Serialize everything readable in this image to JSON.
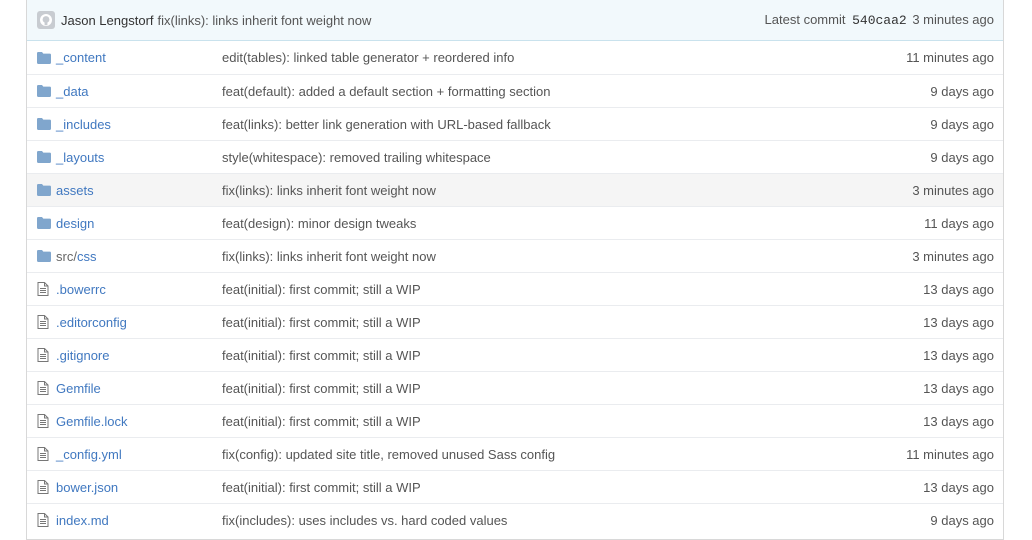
{
  "commit": {
    "author": "Jason Lengstorf",
    "message": "fix(links): links inherit font weight now",
    "latest_label": "Latest commit",
    "sha": "540caa2",
    "age": "3 minutes ago"
  },
  "files": [
    {
      "type": "dir",
      "name": "_content",
      "message": "edit(tables): linked table generator + reordered info",
      "age": "11 minutes ago"
    },
    {
      "type": "dir",
      "name": "_data",
      "message": "feat(default): added a default section + formatting section",
      "age": "9 days ago"
    },
    {
      "type": "dir",
      "name": "_includes",
      "message": "feat(links): better link generation with URL-based fallback",
      "age": "9 days ago"
    },
    {
      "type": "dir",
      "name": "_layouts",
      "message": "style(whitespace): removed trailing whitespace",
      "age": "9 days ago"
    },
    {
      "type": "dir",
      "name": "assets",
      "message": "fix(links): links inherit font weight now",
      "age": "3 minutes ago",
      "hovered": true
    },
    {
      "type": "dir",
      "name": "design",
      "message": "feat(design): minor design tweaks",
      "age": "11 days ago"
    },
    {
      "type": "dir",
      "name": "css",
      "prefix": "src/",
      "message": "fix(links): links inherit font weight now",
      "age": "3 minutes ago"
    },
    {
      "type": "file",
      "name": ".bowerrc",
      "message": "feat(initial): first commit; still a WIP",
      "age": "13 days ago"
    },
    {
      "type": "file",
      "name": ".editorconfig",
      "message": "feat(initial): first commit; still a WIP",
      "age": "13 days ago"
    },
    {
      "type": "file",
      "name": ".gitignore",
      "message": "feat(initial): first commit; still a WIP",
      "age": "13 days ago"
    },
    {
      "type": "file",
      "name": "Gemfile",
      "message": "feat(initial): first commit; still a WIP",
      "age": "13 days ago"
    },
    {
      "type": "file",
      "name": "Gemfile.lock",
      "message": "feat(initial): first commit; still a WIP",
      "age": "13 days ago"
    },
    {
      "type": "file",
      "name": "_config.yml",
      "message": "fix(config): updated site title, removed unused Sass config",
      "age": "11 minutes ago"
    },
    {
      "type": "file",
      "name": "bower.json",
      "message": "feat(initial): first commit; still a WIP",
      "age": "13 days ago"
    },
    {
      "type": "file",
      "name": "index.md",
      "message": "fix(includes): uses includes vs. hard coded values",
      "age": "9 days ago"
    }
  ],
  "colors": {
    "link": "#4078c0",
    "folder_icon": "#80a6cd",
    "file_icon": "#777777",
    "commit_bar_bg": "#f2f9fc",
    "hover_row_bg": "#f5f5f5"
  },
  "icons": {
    "avatar": "github-octocat-avatar",
    "dir": "folder-icon",
    "file": "file-text-icon"
  }
}
